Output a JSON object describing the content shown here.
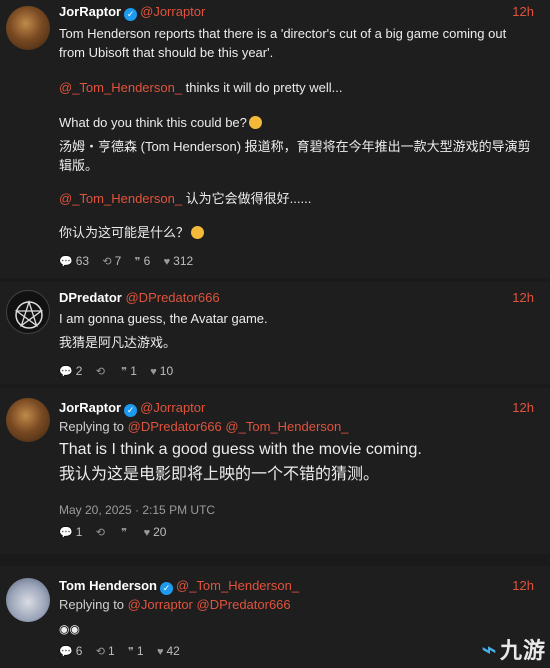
{
  "posts": [
    {
      "name": "JorRaptor",
      "handle": "@Jorraptor",
      "time": "12h",
      "line1": "Tom Henderson reports that there is a 'director's cut of a big game coming out",
      "line2": "from Ubisoft that should be this year'.",
      "mention": "@_Tom_Henderson_",
      "line3": " thinks it will do pretty well...",
      "line4": "What do you think this could be?",
      "cn1": "汤姆・亨德森 (Tom Henderson) 报道称，育碧将在今年推出一款大型游戏的导演剪",
      "cn2": "辑版。",
      "cn3_mention": "@_Tom_Henderson_",
      "cn3": " 认为它会做得很好......",
      "cn4": "你认为这可能是什么？",
      "stats": {
        "replies": "63",
        "reposts": "7",
        "quotes": "6",
        "likes": "312"
      }
    },
    {
      "name": "DPredator",
      "handle": "@DPredator666",
      "time": "12h",
      "line1": "I am gonna guess, the Avatar game.",
      "cn1": "我猜是阿凡达游戏。",
      "stats": {
        "replies": "2",
        "reposts": "",
        "quotes": "1",
        "likes": "10"
      }
    },
    {
      "name": "JorRaptor",
      "handle": "@Jorraptor",
      "time": "12h",
      "reply_prefix": "Replying to ",
      "reply_to1": "@DPredator666",
      "reply_to2": "@_Tom_Henderson_",
      "line1": "That is I think a good guess with the movie coming.",
      "cn1": "我认为这是电影即将上映的一个不错的猜测。",
      "date": "May 20, 2025 · 2:15 PM UTC",
      "stats": {
        "replies": "1",
        "reposts": "",
        "quotes": "",
        "likes": "20"
      }
    },
    {
      "name": "Tom Henderson",
      "handle": "@_Tom_Henderson_",
      "time": "12h",
      "reply_prefix": "Replying to ",
      "reply_to1": "@Jorraptor",
      "reply_to2": "@DPredator666",
      "stats": {
        "replies": "6",
        "reposts": "1",
        "quotes": "1",
        "likes": "42"
      }
    }
  ],
  "icons": {
    "reply": "comment-icon",
    "repost": "retweet-icon",
    "quote": "quote-icon",
    "like": "heart-icon",
    "verified": "verified-badge-icon"
  },
  "colors": {
    "accent": "#e0533c",
    "background": "#1a1a1b",
    "verified": "#1d9bf0"
  }
}
